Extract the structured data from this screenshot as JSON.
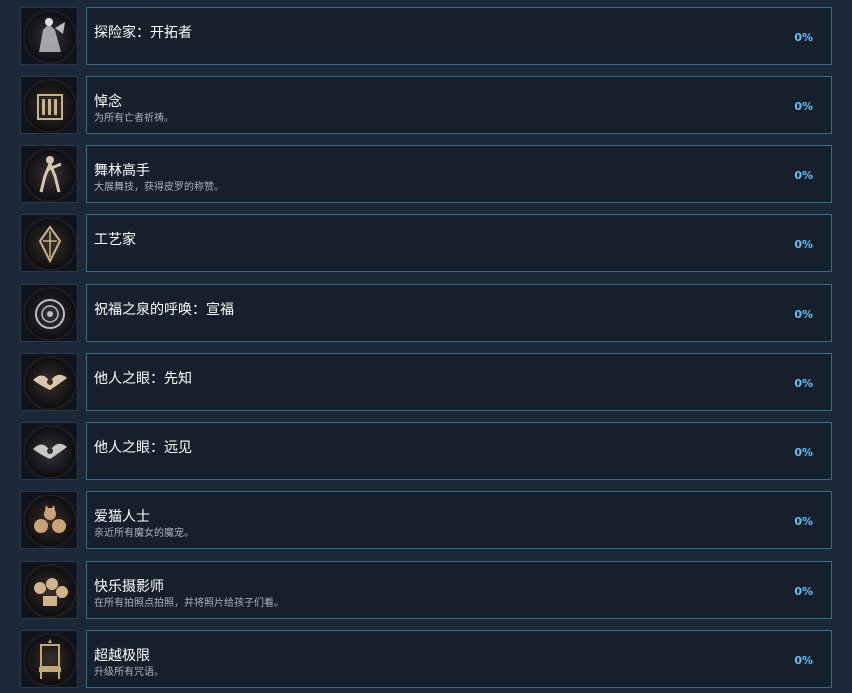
{
  "achievements": [
    {
      "title": "探险家：开拓者",
      "description": "",
      "percent": "0%",
      "icon": "explorer-icon",
      "accent": "#c9c9c9"
    },
    {
      "title": "悼念",
      "description": "为所有亡者祈祷。",
      "percent": "0%",
      "icon": "shrine-icon",
      "accent": "#b9a27a"
    },
    {
      "title": "舞林高手",
      "description": "大展舞技，获得皮罗的称赞。",
      "percent": "0%",
      "icon": "dancer-icon",
      "accent": "#d6c4a8"
    },
    {
      "title": "工艺家",
      "description": "",
      "percent": "0%",
      "icon": "craft-icon",
      "accent": "#c8b48a"
    },
    {
      "title": "祝福之泉的呼唤：宣福",
      "description": "",
      "percent": "0%",
      "icon": "fountain-icon",
      "accent": "#bdbdbd"
    },
    {
      "title": "他人之眼：先知",
      "description": "",
      "percent": "0%",
      "icon": "eye-bird-icon",
      "accent": "#d8c8ae"
    },
    {
      "title": "他人之眼：远见",
      "description": "",
      "percent": "0%",
      "icon": "eye-bird-grey-icon",
      "accent": "#c8c8c8"
    },
    {
      "title": "爱猫人士",
      "description": "亲近所有魔女的魔宠。",
      "percent": "0%",
      "icon": "cats-icon",
      "accent": "#caa27a"
    },
    {
      "title": "快乐摄影师",
      "description": "在所有拍照点拍照，并将照片给孩子们看。",
      "percent": "0%",
      "icon": "children-icon",
      "accent": "#d2b48c"
    },
    {
      "title": "超越极限",
      "description": "升级所有咒语。",
      "percent": "0%",
      "icon": "throne-icon",
      "accent": "#c4a878"
    }
  ]
}
